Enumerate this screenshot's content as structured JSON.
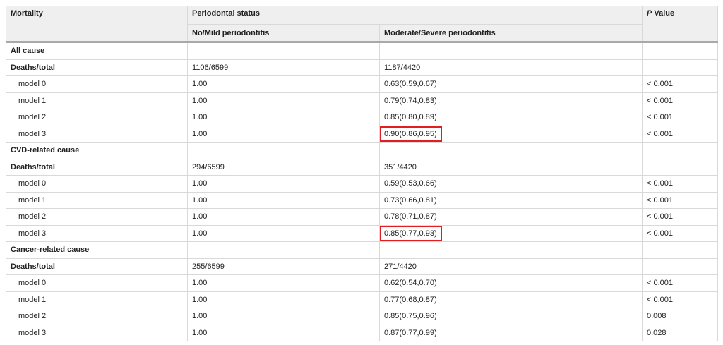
{
  "header": {
    "mortality": "Mortality",
    "periodontal_status": "Periodontal status",
    "no_mild": "No/Mild periodontitis",
    "moderate_severe": "Moderate/Severe periodontitis",
    "p_italic": "P",
    "p_rest": " Value"
  },
  "sections": [
    {
      "title": "All cause",
      "deaths_label": "Deaths/total",
      "deaths_no_mild": "1106/6599",
      "deaths_mod_sev": "1187/4420",
      "models": [
        {
          "label": "model 0",
          "no_mild": "1.00",
          "mod_sev": "0.63(0.59,0.67)",
          "p": "< 0.001",
          "highlight": false
        },
        {
          "label": "model 1",
          "no_mild": "1.00",
          "mod_sev": "0.79(0.74,0.83)",
          "p": "< 0.001",
          "highlight": false
        },
        {
          "label": "model 2",
          "no_mild": "1.00",
          "mod_sev": "0.85(0.80,0.89)",
          "p": "< 0.001",
          "highlight": false
        },
        {
          "label": "model 3",
          "no_mild": "1.00",
          "mod_sev": "0.90(0.86,0.95)",
          "p": "< 0.001",
          "highlight": true
        }
      ]
    },
    {
      "title": "CVD-related cause",
      "deaths_label": "Deaths/total",
      "deaths_no_mild": "294/6599",
      "deaths_mod_sev": "351/4420",
      "models": [
        {
          "label": "model 0",
          "no_mild": "1.00",
          "mod_sev": "0.59(0.53,0.66)",
          "p": "< 0.001",
          "highlight": false
        },
        {
          "label": "model 1",
          "no_mild": "1.00",
          "mod_sev": "0.73(0.66,0.81)",
          "p": "< 0.001",
          "highlight": false
        },
        {
          "label": "model 2",
          "no_mild": "1.00",
          "mod_sev": "0.78(0.71,0.87)",
          "p": "< 0.001",
          "highlight": false
        },
        {
          "label": "model 3",
          "no_mild": "1.00",
          "mod_sev": "0.85(0.77,0.93)",
          "p": "< 0.001",
          "highlight": true
        }
      ]
    },
    {
      "title": "Cancer-related cause",
      "deaths_label": "Deaths/total",
      "deaths_no_mild": "255/6599",
      "deaths_mod_sev": "271/4420",
      "models": [
        {
          "label": "model 0",
          "no_mild": "1.00",
          "mod_sev": "0.62(0.54,0.70)",
          "p": "< 0.001",
          "highlight": false
        },
        {
          "label": "model 1",
          "no_mild": "1.00",
          "mod_sev": "0.77(0.68,0.87)",
          "p": "< 0.001",
          "highlight": false
        },
        {
          "label": "model 2",
          "no_mild": "1.00",
          "mod_sev": "0.85(0.75,0.96)",
          "p": "0.008",
          "highlight": false
        },
        {
          "label": "model 3",
          "no_mild": "1.00",
          "mod_sev": "0.87(0.77,0.99)",
          "p": "0.028",
          "highlight": false
        }
      ]
    }
  ],
  "colors": {
    "header_bg": "#efefef",
    "grid": "#d9d9d9",
    "header_rule": "#a9a9a9",
    "highlight_box": "#e02020"
  }
}
